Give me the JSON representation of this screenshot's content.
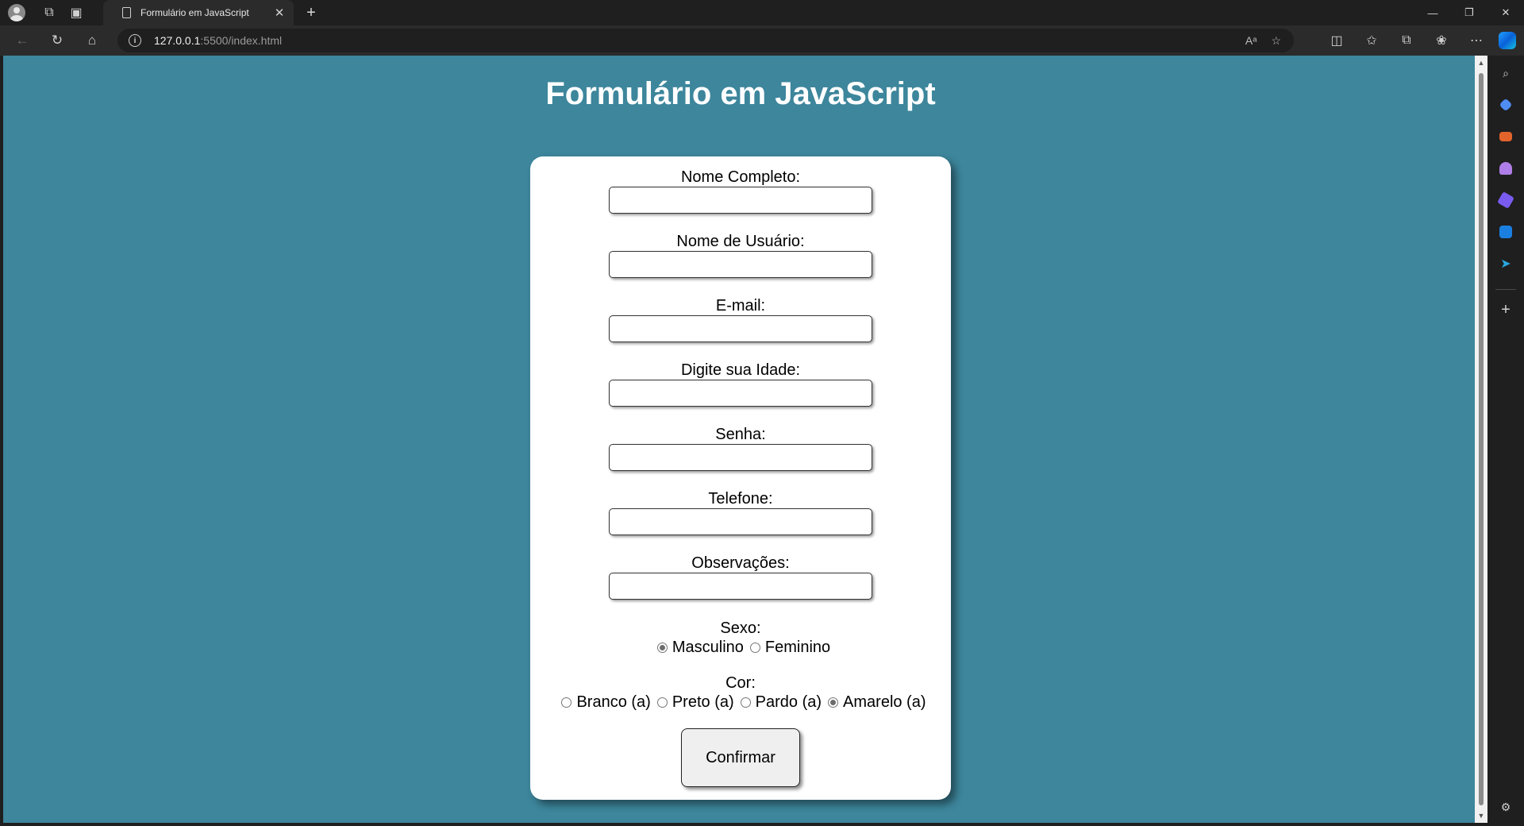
{
  "browser": {
    "tab_title": "Formulário em JavaScript",
    "url_host": "127.0.0.1",
    "url_rest": ":5500/index.html",
    "icons": {
      "profile": "profile-icon",
      "workspaces": "workspaces-icon",
      "tab_actions": "tab-actions-icon",
      "back": "back-arrow-icon",
      "refresh": "refresh-icon",
      "home": "home-icon",
      "read_aloud": "read-aloud-icon",
      "favorite": "star-icon",
      "split_screen": "split-screen-icon",
      "favorites": "favorites-icon",
      "collections": "collections-icon",
      "extensions": "extensions-icon",
      "more": "more-icon",
      "copilot": "copilot-icon"
    }
  },
  "sidebar": {
    "items": [
      {
        "name": "search",
        "color": "#d0d0d0"
      },
      {
        "name": "shopping",
        "color": "#4f8df5"
      },
      {
        "name": "tools",
        "color": "#e3642a"
      },
      {
        "name": "games",
        "color": "#b07ee8"
      },
      {
        "name": "microsoft-365",
        "color": "#7a5bf0"
      },
      {
        "name": "outlook",
        "color": "#1a7fe0"
      },
      {
        "name": "telegram",
        "color": "#2aa6e0"
      }
    ]
  },
  "page": {
    "title": "Formulário em JavaScript",
    "background": "#3d869c"
  },
  "form": {
    "fields": [
      {
        "label": "Nome Completo:",
        "value": ""
      },
      {
        "label": "Nome de Usuário:",
        "value": ""
      },
      {
        "label": "E-mail:",
        "value": ""
      },
      {
        "label": "Digite sua Idade:",
        "value": ""
      },
      {
        "label": "Senha:",
        "value": ""
      },
      {
        "label": "Telefone:",
        "value": ""
      },
      {
        "label": "Observações:",
        "value": ""
      }
    ],
    "sexo": {
      "label": "Sexo:",
      "options": [
        {
          "label": "Masculino",
          "checked": true
        },
        {
          "label": "Feminino",
          "checked": false
        }
      ]
    },
    "cor": {
      "label": "Cor:",
      "options": [
        {
          "label": "Branco (a)",
          "checked": false
        },
        {
          "label": "Preto (a)",
          "checked": false
        },
        {
          "label": "Pardo (a)",
          "checked": false
        },
        {
          "label": "Amarelo (a)",
          "checked": true
        }
      ]
    },
    "submit_label": "Confirmar"
  }
}
